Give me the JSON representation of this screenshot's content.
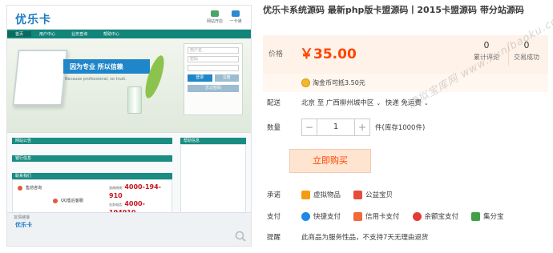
{
  "preview": {
    "logo": "优乐卡",
    "top_icons": [
      {
        "label": "网站开店",
        "color": "#4aa56a"
      },
      {
        "label": "一卡通",
        "color": "#2d8ad0"
      }
    ],
    "nav": [
      "首页",
      "用户中心",
      "业务查询",
      "帮助中心"
    ],
    "banner_tag": "因为专业 所以信赖",
    "banner_sub": "Because professional, so trust.",
    "login": {
      "user_placeholder": "用户名",
      "pass_placeholder": "密码",
      "btn_login": "登录",
      "btn_register": "注册",
      "btn_forgot": "忘记密码"
    },
    "sections": [
      "网站公告",
      "银行信息",
      "联系我们"
    ],
    "help": "帮助信息",
    "contact": {
      "qq1": "售前咨询",
      "qq2": "QQ售后客服",
      "phones": [
        {
          "label": "咨询热线:",
          "num": "4000-194-910"
        },
        {
          "label": "业务电话:",
          "num": "4000-194910"
        },
        {
          "label": "售后电话:",
          "num": "4000-194910"
        }
      ]
    },
    "foot_logo": "优乐卡",
    "foot_links": "友情链接"
  },
  "product": {
    "title": "优乐卡系统源码 最新php版卡盟源码丨2015卡盟源码 带分站源码",
    "price_label": "价格",
    "price": "￥35.00",
    "stats": [
      {
        "num": "0",
        "label": "累计评论"
      },
      {
        "num": "0",
        "label": "交易成功"
      }
    ],
    "coin_text": "淘金币可抵3.50元",
    "ship_label": "配送",
    "ship_from": "北京 至",
    "ship_to": "广西柳州城中区",
    "ship_method": "快递 免运费",
    "qty_label": "数量",
    "qty_value": "1",
    "stock_text": "件(库存1000件)",
    "buy_label": "立即购买",
    "promise_label": "承诺",
    "promises": [
      {
        "text": "虚拟物品",
        "color": "#f39c12"
      },
      {
        "text": "公益宝贝",
        "color": "#e74c3c"
      }
    ],
    "pay_label": "支付",
    "pays": [
      {
        "text": "快捷支付",
        "color": "#1e88e5"
      },
      {
        "text": "信用卡支付",
        "color": "#f06a3a"
      },
      {
        "text": "余额宝支付",
        "color": "#e53935"
      },
      {
        "text": "集分宝",
        "color": "#43a047"
      }
    ],
    "tip_label": "提醒",
    "tip_text": "此商品为服务性品，不支持7天无理由退货"
  },
  "watermark": "虚拟宝库网 www.xunibaoku.com"
}
